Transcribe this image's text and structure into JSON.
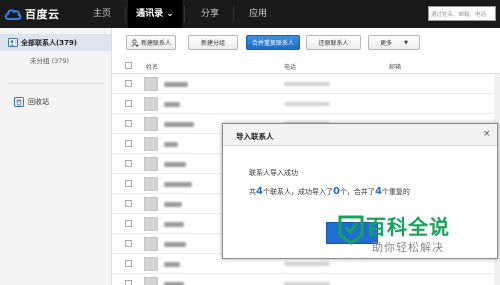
{
  "app": {
    "logo_text": "百度云"
  },
  "nav": {
    "items": [
      {
        "label": "主页"
      },
      {
        "label": "通讯录 ⌄"
      },
      {
        "label": "分享"
      },
      {
        "label": "应用"
      }
    ],
    "search_placeholder": "通过姓名、邮箱、电话",
    "active_index": 1
  },
  "sidebar": {
    "all_contacts_label": "全部联系人(379)",
    "unsorted_label": "未分组 (379)",
    "recycle_label": "回收站"
  },
  "toolbar": {
    "new_contact": "新建联系人",
    "new_group": "新建分组",
    "merge_duplicates": "合并重复联系人",
    "restore_contacts": "还原联系人",
    "more": "更多"
  },
  "table": {
    "headers": {
      "name": "姓名",
      "phone": "电话",
      "email": "邮箱"
    },
    "rows": [
      {
        "name_width": 24
      },
      {
        "name_width": 16
      },
      {
        "name_width": 30
      },
      {
        "name_width": 14
      },
      {
        "name_width": 22
      },
      {
        "name_width": 28
      },
      {
        "name_width": 18
      },
      {
        "name_width": 20
      },
      {
        "name_width": 22
      },
      {
        "name_width": 16
      },
      {
        "name_width": 20
      }
    ]
  },
  "dialog": {
    "title": "导入联系人",
    "close": "×",
    "message": "联系人导入成功",
    "stats": {
      "prefix": "共",
      "total": "4",
      "part1": "个联系人，成功导入了",
      "imported": "0",
      "part2": "个，合并了",
      "merged": "4",
      "part3": "个重复的"
    }
  },
  "watermark": {
    "title": "百科全说",
    "subtitle": "助你轻松解决"
  },
  "colors": {
    "topbar": "#1a1a1a",
    "accent_blue": "#1e6fd0",
    "watermark_green": "#17a35c"
  }
}
